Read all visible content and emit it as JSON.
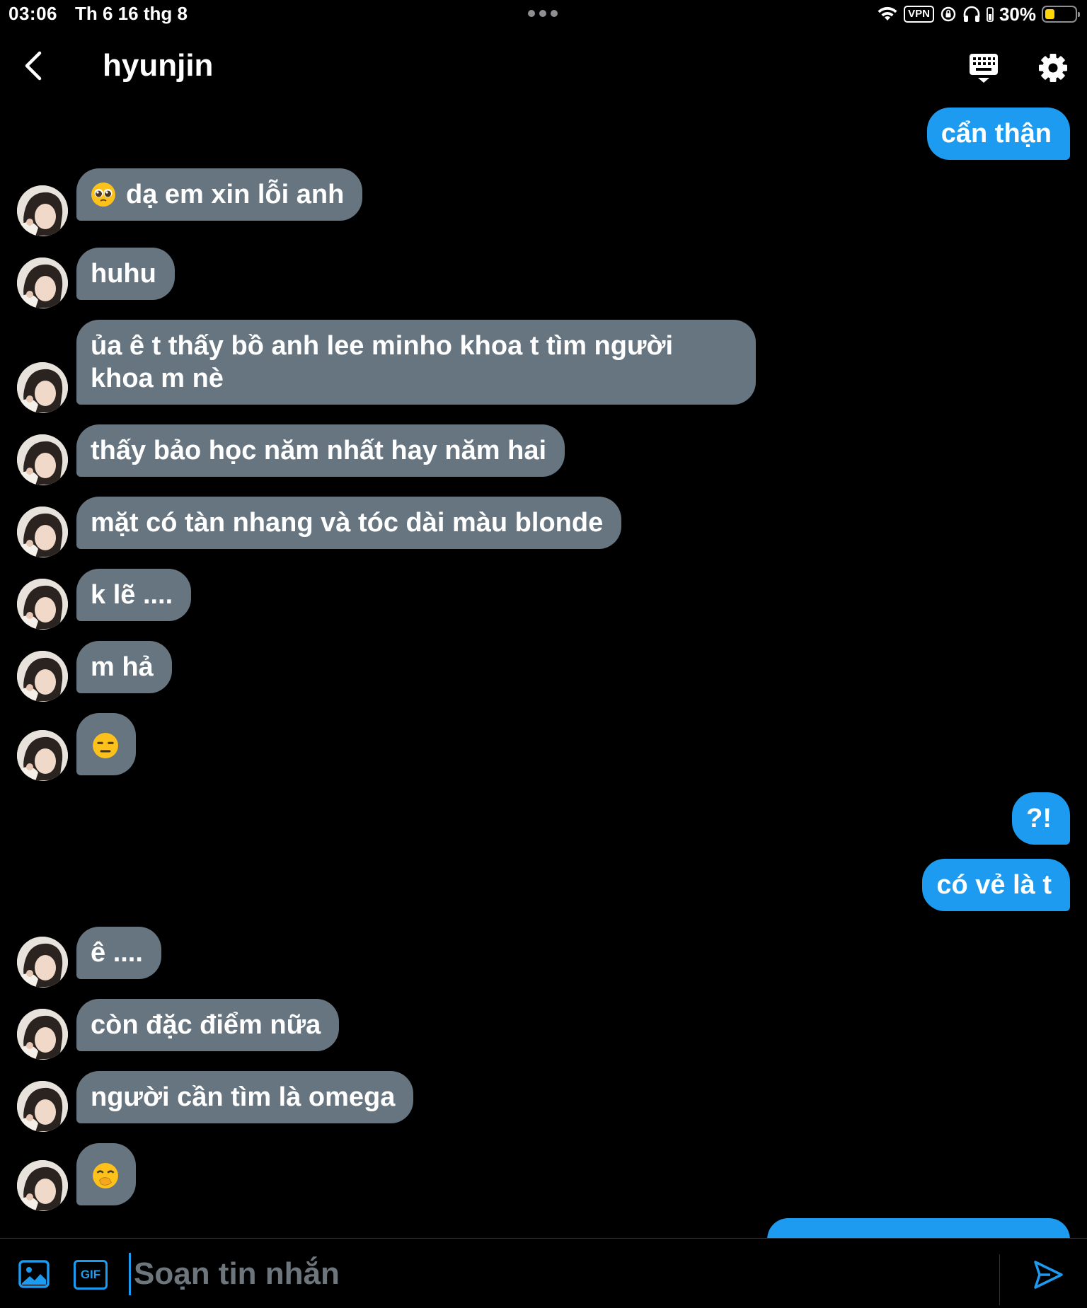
{
  "status_bar": {
    "time": "03:06",
    "date": "Th 6 16 thg 8",
    "vpn": "VPN",
    "battery": "30%",
    "battery_level": 0.3
  },
  "header": {
    "title": "hyunjin"
  },
  "messages": [
    {
      "dir": "out",
      "text": "cẩn thận"
    },
    {
      "dir": "in",
      "emoji": "pleading-face",
      "text": "dạ em xin lỗi anh"
    },
    {
      "dir": "in",
      "text": "huhu"
    },
    {
      "dir": "in",
      "text": "ủa ê t thấy bồ anh lee minho khoa t tìm người khoa m nè"
    },
    {
      "dir": "in",
      "text": "thấy bảo học năm nhất hay năm hai"
    },
    {
      "dir": "in",
      "text": "mặt có tàn nhang và tóc dài màu blonde"
    },
    {
      "dir": "in",
      "text": "k lẽ ...."
    },
    {
      "dir": "in",
      "text": "m hả"
    },
    {
      "dir": "in",
      "emoji": "expressionless-face",
      "text": ""
    },
    {
      "dir": "out",
      "text": "?!"
    },
    {
      "dir": "out",
      "text": "có vẻ là t"
    },
    {
      "dir": "in",
      "text": "ê ...."
    },
    {
      "dir": "in",
      "text": "còn đặc điểm nữa"
    },
    {
      "dir": "in",
      "text": "người cần tìm là omega"
    },
    {
      "dir": "in",
      "emoji": "hand-over-mouth-face",
      "text": ""
    }
  ],
  "composer": {
    "placeholder": "Soạn tin nhắn",
    "gif_label": "GIF"
  },
  "colors": {
    "incoming_bubble": "#66757f",
    "outgoing_bubble": "#1d9bf0",
    "accent": "#1d9bf0",
    "background": "#000000"
  }
}
